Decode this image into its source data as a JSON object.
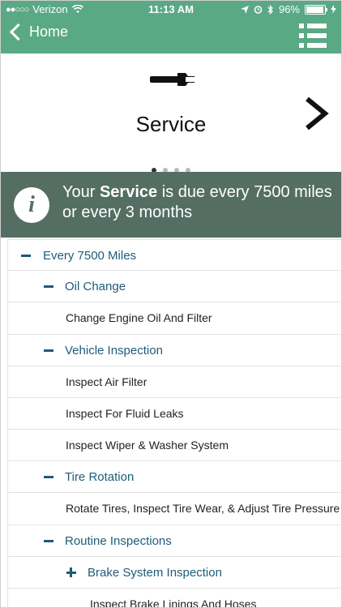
{
  "status_bar": {
    "carrier": "Verizon",
    "time": "11:13 AM",
    "battery": "96%",
    "battery_level": 0.96
  },
  "nav": {
    "back_label": "Home"
  },
  "carousel": {
    "title": "Service",
    "page_count": 4,
    "active_page": 1
  },
  "banner": {
    "prefix": "Your ",
    "bold": "Service",
    "suffix": " is due every 7500 miles or every 3 months"
  },
  "schedule": {
    "group": "Every 7500 Miles",
    "oil_change": "Oil Change",
    "oil_items": [
      "Change Engine Oil And Filter"
    ],
    "vehicle_inspection": "Vehicle Inspection",
    "vehicle_items": [
      "Inspect Air Filter",
      "Inspect For Fluid Leaks",
      "Inspect Wiper & Washer System"
    ],
    "tire_rotation": "Tire Rotation",
    "tire_items": [
      "Rotate Tires, Inspect Tire Wear, & Adjust Tire Pressure"
    ],
    "routine_inspections": "Routine Inspections",
    "brake_system": "Brake System Inspection",
    "brake_items": [
      "Inspect Brake Linings And Hoses"
    ]
  },
  "colors": {
    "header_green": "#5aa985",
    "banner_gray": "#546e63",
    "link_blue": "#1e5b7a"
  }
}
